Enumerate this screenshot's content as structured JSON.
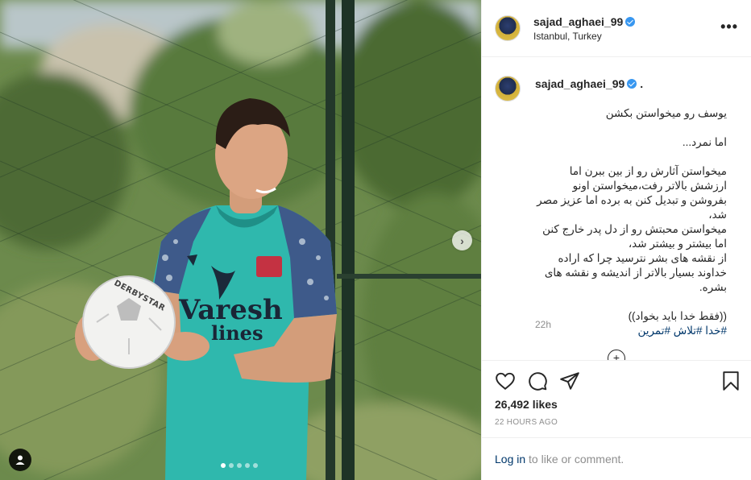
{
  "post": {
    "username": "sajad_aghaei_99",
    "location": "Istanbul, Turkey",
    "more_icon": "more-horizontal-icon",
    "caption_suffix": ".",
    "caption": "یوسف رو میخواستن بکشن\n\nاما نمرد...\n\nمیخواستن آثارش رو از بین ببرن اما ارزشش بالاتر رفت،میخواستن اونو بفروشن و تبدیل کنن به برده اما عزیز مصر شد،\nمیخواستن محبتش رو از دل پدر خارج کنن اما بیشتر و بیشتر شد،\nاز نقشه های بشر نترسید چرا که اراده خداوند بسیار بالاتر از اندیشه و نقشه های بشره.\n\n((فقط خدا باید بخواد))",
    "hashtags": "#خدا #تلاش #تمرین",
    "comment_time": "22h",
    "likes": "26,492 likes",
    "posted_ago": "22 HOURS AGO"
  },
  "photo": {
    "shirt_text_line1": "Varesh",
    "shirt_text_line2": "lines",
    "ball_text": "DERBYSTAR",
    "carousel_count": 5,
    "carousel_active": 0
  },
  "login_prompt": {
    "link_label": "Log in",
    "rest": " to like or comment."
  },
  "colors": {
    "link": "#00376b",
    "verified": "#3897f0",
    "muted": "#8e8e8e",
    "jersey": "#2fb8ad"
  }
}
